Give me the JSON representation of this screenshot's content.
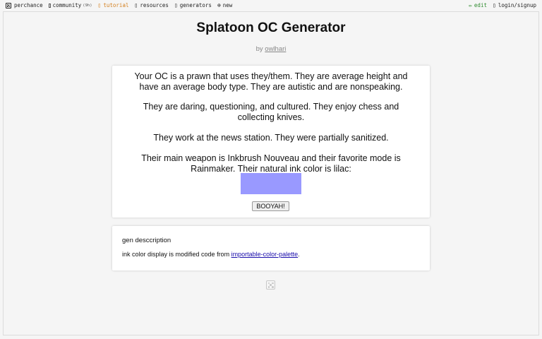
{
  "nav": {
    "left": [
      {
        "label": "perchance",
        "icon": "dice-icon"
      },
      {
        "label": "community",
        "badge": "(9h)",
        "icon": "people-icon"
      },
      {
        "label": "tutorial",
        "icon": "book-icon"
      },
      {
        "label": "resources",
        "icon": "book-icon"
      },
      {
        "label": "generators",
        "icon": "list-icon"
      },
      {
        "label": "new",
        "icon": "plus-circle-icon"
      }
    ],
    "right": [
      {
        "label": "edit",
        "icon": "pencil-icon"
      },
      {
        "label": "login/signup",
        "icon": "user-icon"
      }
    ]
  },
  "page": {
    "title": "Splatoon OC Generator",
    "by_prefix": "by",
    "author": "owlhari"
  },
  "output": {
    "paragraphs": [
      "Your OC is a prawn that uses they/them. They are average height and have an average body type. They are autistic and are nonspeaking.",
      "They are daring, questioning, and cultured. They enjoy chess and collecting knives.",
      "They work at the news station. They were partially sanitized.",
      "Their main weapon is Inkbrush Nouveau and their favorite mode is Rainmaker. Their natural ink color is lilac:"
    ],
    "ink_color": "#9999ff",
    "button_label": "BOOYAH!"
  },
  "description": {
    "title": "gen desccription",
    "text_before": "ink color display is modified code from ",
    "link_text": "importable-color-palette",
    "text_after": "."
  },
  "colors": {
    "tutorial": "#d4801f",
    "edit": "#2e8b2e",
    "link": "#1a0dab"
  }
}
